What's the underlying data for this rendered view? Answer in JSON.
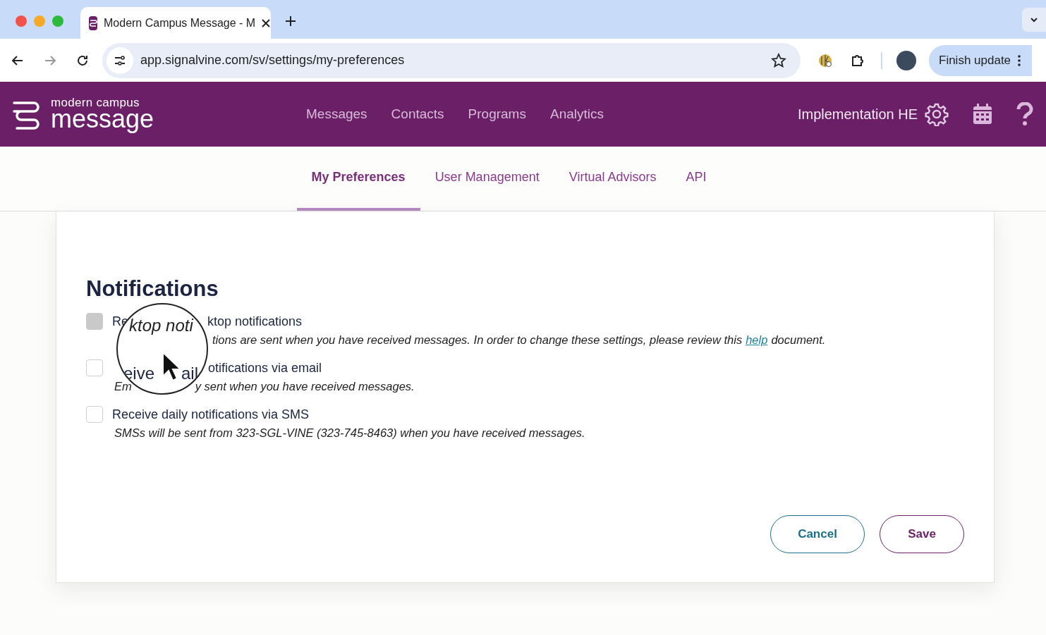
{
  "browser": {
    "tabs": [
      {
        "title": "Modern Campus Message - M",
        "selected": true
      }
    ],
    "url": "app.signalvine.com/sv/settings/my-preferences",
    "update_button": "Finish update"
  },
  "header": {
    "brand_small": "modern campus",
    "brand_large": "message",
    "nav": [
      {
        "label": "Messages"
      },
      {
        "label": "Contacts"
      },
      {
        "label": "Programs"
      },
      {
        "label": "Analytics"
      }
    ],
    "org": "Implementation HE"
  },
  "subnav": [
    {
      "label": "My Preferences",
      "selected": true
    },
    {
      "label": "User Management",
      "selected": false
    },
    {
      "label": "Virtual Advisors",
      "selected": false
    },
    {
      "label": "API",
      "selected": false
    }
  ],
  "notifications": {
    "title": "Notifications",
    "options": [
      {
        "checked": false,
        "disabled": true,
        "label_parts": [
          "Re",
          "ktop notifications"
        ],
        "description_parts": [
          {
            "kind": "text",
            "text": "tions are sent when you have received messages. In order to change these settings, please review this"
          },
          {
            "kind": "link",
            "text": "help"
          },
          {
            "kind": "text",
            "text": "document."
          }
        ]
      },
      {
        "checked": false,
        "disabled": false,
        "label_parts": [
          "otifications via email"
        ],
        "description_parts": [
          {
            "kind": "text",
            "text": "Em"
          },
          {
            "kind": "text",
            "text": "y sent when you have received messages."
          }
        ]
      },
      {
        "checked": false,
        "disabled": false,
        "label_parts": [
          "Receive daily notifications via SMS"
        ],
        "description_parts": [
          {
            "kind": "text",
            "text": "SMSs will be sent from 323-SGL-VINE (323-745-8463) when you have received messages."
          }
        ]
      }
    ],
    "magnifier": {
      "lines": [
        "ktop noti",
        "eive",
        "ail"
      ]
    }
  },
  "buttons": [
    {
      "label": "Cancel",
      "kind": "cancel"
    },
    {
      "label": "Save",
      "kind": "save"
    }
  ]
}
